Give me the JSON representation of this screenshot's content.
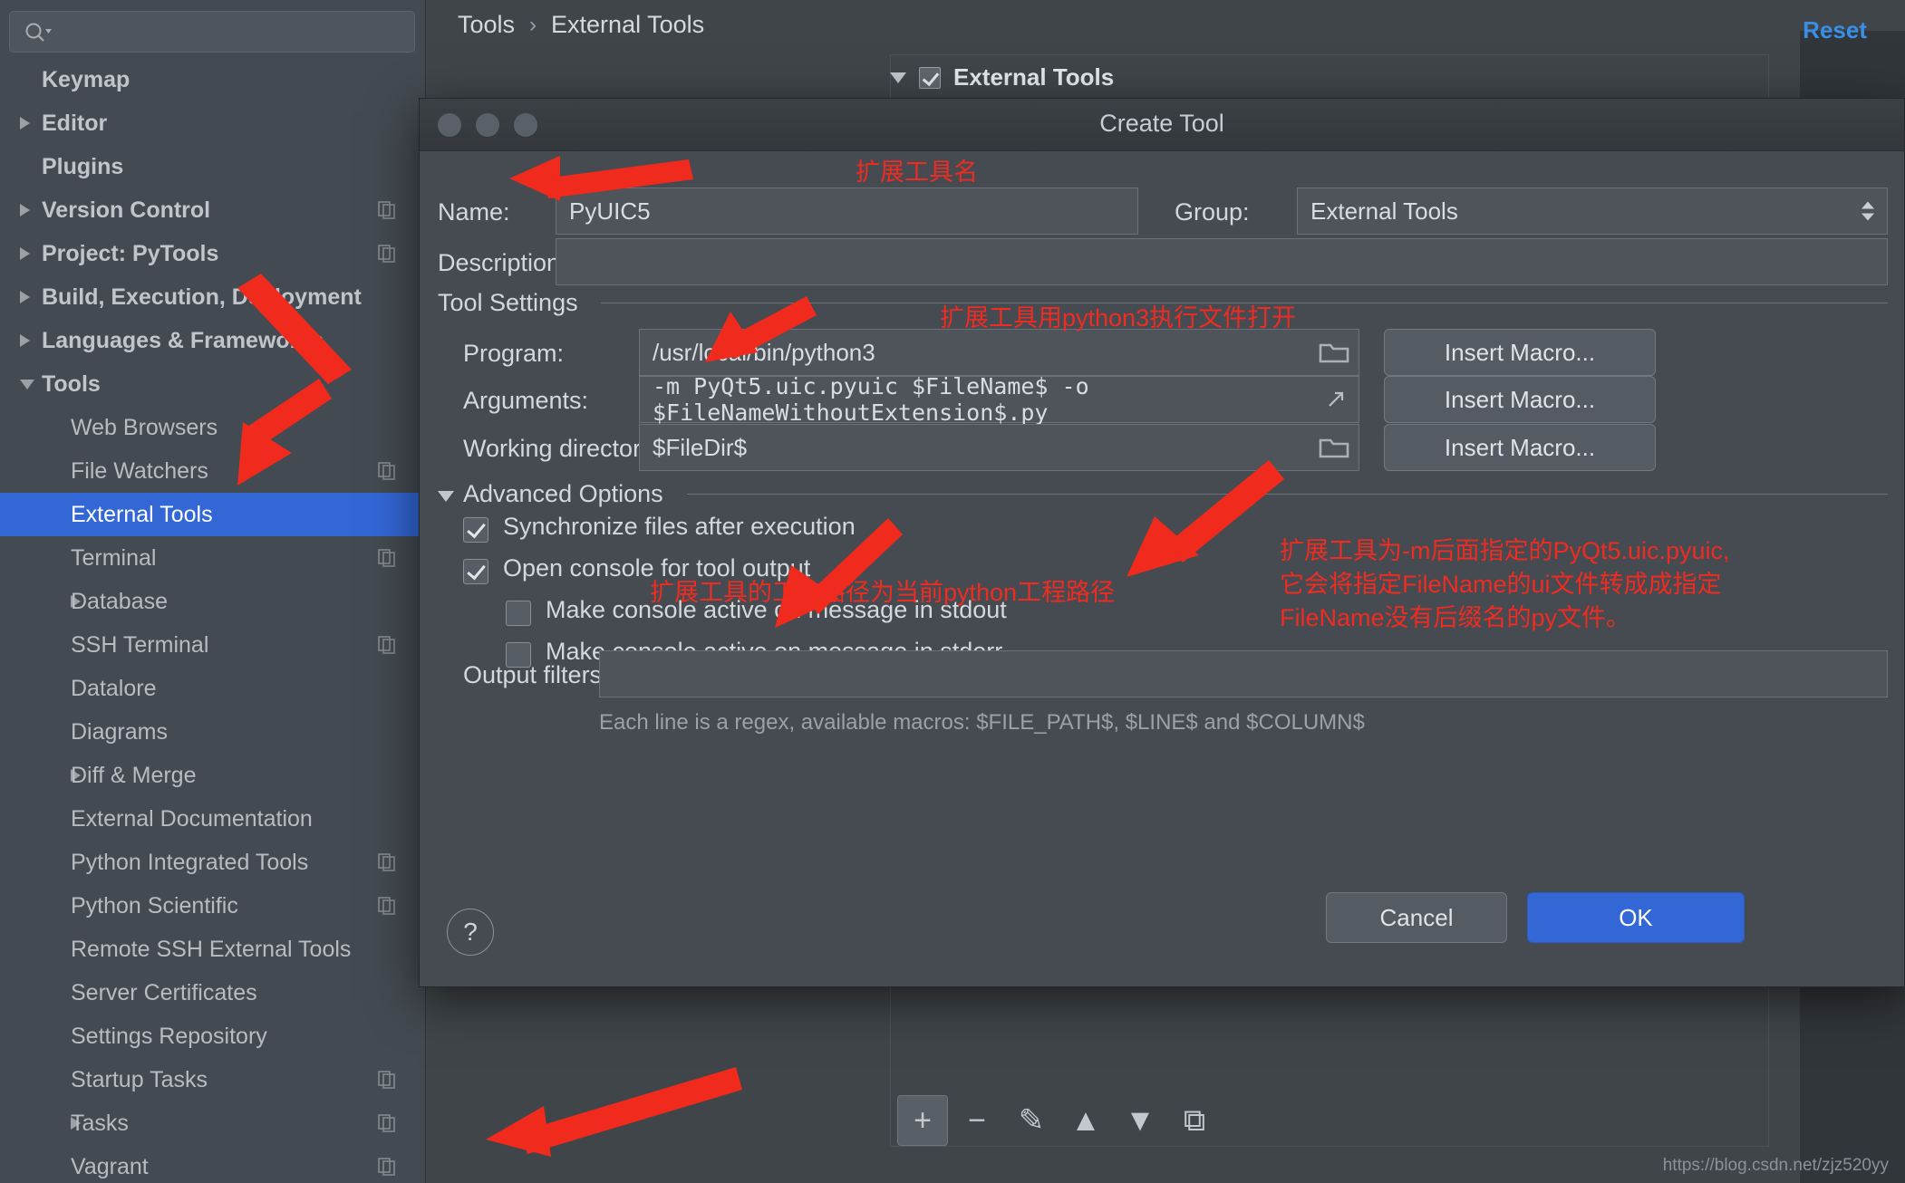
{
  "settings": {
    "search": {
      "placeholder": "",
      "icon": "search-icon"
    },
    "breadcrumb": {
      "parent": "Tools",
      "separator": "›",
      "current": "External Tools"
    },
    "reset_label": "Reset",
    "external_tools_group": "External Tools",
    "watermark": "https://blog.csdn.net/zjz520yy",
    "sidebar_items": [
      {
        "label": "Keymap",
        "indent": 0,
        "arrow": "none",
        "bold": true,
        "copy": false,
        "selected": false
      },
      {
        "label": "Editor",
        "indent": 0,
        "arrow": "right",
        "bold": true,
        "copy": false,
        "selected": false
      },
      {
        "label": "Plugins",
        "indent": 0,
        "arrow": "none",
        "bold": true,
        "copy": false,
        "selected": false
      },
      {
        "label": "Version Control",
        "indent": 0,
        "arrow": "right",
        "bold": true,
        "copy": true,
        "selected": false
      },
      {
        "label": "Project: PyTools",
        "indent": 0,
        "arrow": "right",
        "bold": true,
        "copy": true,
        "selected": false
      },
      {
        "label": "Build, Execution, Deployment",
        "indent": 0,
        "arrow": "right",
        "bold": true,
        "copy": false,
        "selected": false
      },
      {
        "label": "Languages & Frameworks",
        "indent": 0,
        "arrow": "right",
        "bold": true,
        "copy": false,
        "selected": false
      },
      {
        "label": "Tools",
        "indent": 0,
        "arrow": "down",
        "bold": true,
        "copy": false,
        "selected": false
      },
      {
        "label": "Web Browsers",
        "indent": 1,
        "arrow": "none",
        "bold": false,
        "copy": false,
        "selected": false
      },
      {
        "label": "File Watchers",
        "indent": 1,
        "arrow": "none",
        "bold": false,
        "copy": true,
        "selected": false
      },
      {
        "label": "External Tools",
        "indent": 1,
        "arrow": "none",
        "bold": false,
        "copy": false,
        "selected": true
      },
      {
        "label": "Terminal",
        "indent": 1,
        "arrow": "none",
        "bold": false,
        "copy": true,
        "selected": false
      },
      {
        "label": "Database",
        "indent": 1,
        "arrow": "right",
        "bold": false,
        "copy": false,
        "selected": false
      },
      {
        "label": "SSH Terminal",
        "indent": 1,
        "arrow": "none",
        "bold": false,
        "copy": true,
        "selected": false
      },
      {
        "label": "Datalore",
        "indent": 1,
        "arrow": "none",
        "bold": false,
        "copy": false,
        "selected": false
      },
      {
        "label": "Diagrams",
        "indent": 1,
        "arrow": "none",
        "bold": false,
        "copy": false,
        "selected": false
      },
      {
        "label": "Diff & Merge",
        "indent": 1,
        "arrow": "right",
        "bold": false,
        "copy": false,
        "selected": false
      },
      {
        "label": "External Documentation",
        "indent": 1,
        "arrow": "none",
        "bold": false,
        "copy": false,
        "selected": false
      },
      {
        "label": "Python Integrated Tools",
        "indent": 1,
        "arrow": "none",
        "bold": false,
        "copy": true,
        "selected": false
      },
      {
        "label": "Python Scientific",
        "indent": 1,
        "arrow": "none",
        "bold": false,
        "copy": true,
        "selected": false
      },
      {
        "label": "Remote SSH External Tools",
        "indent": 1,
        "arrow": "none",
        "bold": false,
        "copy": false,
        "selected": false
      },
      {
        "label": "Server Certificates",
        "indent": 1,
        "arrow": "none",
        "bold": false,
        "copy": false,
        "selected": false
      },
      {
        "label": "Settings Repository",
        "indent": 1,
        "arrow": "none",
        "bold": false,
        "copy": false,
        "selected": false
      },
      {
        "label": "Startup Tasks",
        "indent": 1,
        "arrow": "none",
        "bold": false,
        "copy": true,
        "selected": false
      },
      {
        "label": "Tasks",
        "indent": 1,
        "arrow": "right",
        "bold": false,
        "copy": true,
        "selected": false
      },
      {
        "label": "Vagrant",
        "indent": 1,
        "arrow": "none",
        "bold": false,
        "copy": true,
        "selected": false
      }
    ],
    "toolbar": [
      {
        "icon": "plus-icon",
        "glyph": "+",
        "active": true
      },
      {
        "icon": "minus-icon",
        "glyph": "−",
        "active": false
      },
      {
        "icon": "edit-pencil-icon",
        "glyph": "✎",
        "active": false
      },
      {
        "icon": "move-up-icon",
        "glyph": "▲",
        "active": false
      },
      {
        "icon": "move-down-icon",
        "glyph": "▼",
        "active": false
      },
      {
        "icon": "copy-icon",
        "glyph": "⧉",
        "active": false
      }
    ]
  },
  "dialog": {
    "title": "Create Tool",
    "name_label": "Name:",
    "name_value": "PyUIC5",
    "group_label": "Group:",
    "group_value": "External Tools",
    "description_label": "Description:",
    "description_value": "",
    "tool_settings_title": "Tool Settings",
    "program_label": "Program:",
    "program_value": "/usr/local/bin/python3",
    "arguments_label": "Arguments:",
    "arguments_value": "-m PyQt5.uic.pyuic $FileName$ -o $FileNameWithoutExtension$.py",
    "working_dir_label": "Working directory:",
    "working_dir_value": "$FileDir$",
    "insert_macro_label": "Insert Macro...",
    "advanced_options_title": "Advanced Options",
    "checkboxes": [
      {
        "label": "Synchronize files after execution",
        "checked": true,
        "indent": 0
      },
      {
        "label": "Open console for tool output",
        "checked": true,
        "indent": 0
      },
      {
        "label": "Make console active on message in stdout",
        "checked": false,
        "indent": 1
      },
      {
        "label": "Make console active on message in stderr",
        "checked": false,
        "indent": 1
      }
    ],
    "output_filters_label": "Output filters:",
    "output_filters_value": "",
    "output_filters_hint": "Each line is a regex, available macros: $FILE_PATH$, $LINE$ and $COLUMN$",
    "help_glyph": "?",
    "cancel_label": "Cancel",
    "ok_label": "OK"
  },
  "annotations": {
    "color": "#ef2b22",
    "name_note": "扩展工具名",
    "program_note": "扩展工具用python3执行文件打开",
    "workdir_note": "扩展工具的工作路径为当前python工程路径",
    "arguments_note_line1": "扩展工具为-m后面指定的PyQt5.uic.pyuic,",
    "arguments_note_line2": "它会将指定FileName的ui文件转成成指定",
    "arguments_note_line3": "FileName没有后缀名的py文件。"
  }
}
